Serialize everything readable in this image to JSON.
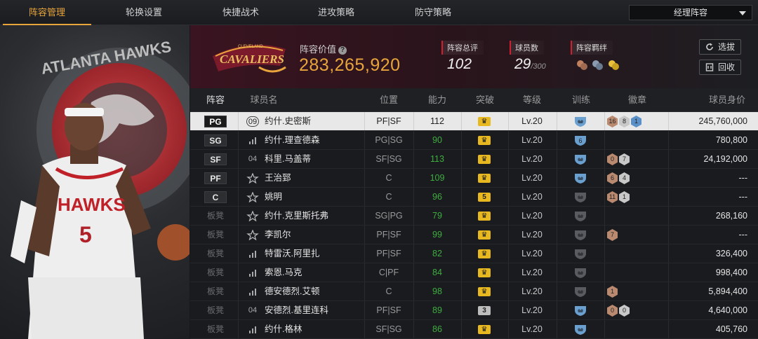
{
  "nav": {
    "tabs": [
      "阵容管理",
      "轮换设置",
      "快捷战术",
      "进攻策略",
      "防守策略"
    ],
    "active_tab": 0,
    "dropdown_value": "经理阵容"
  },
  "summary": {
    "team_logo_text": "CAVALIERS",
    "team_logo_sub": "CLEVELAND",
    "value_label": "阵容价值",
    "value": "283,265,920",
    "overall_label": "阵容总评",
    "overall": "102",
    "players_label": "球员数",
    "players": "29",
    "players_max": "/300",
    "bond_label": "阵容羁绊",
    "select_button": "选拔",
    "recycle_button": "回收"
  },
  "player_art": {
    "ring_text": "ATLANTA HAWKS",
    "jersey_text": "HAWKS",
    "jersey_number": "5"
  },
  "table": {
    "headers": [
      "阵容",
      "球员名",
      "位置",
      "能力",
      "突破",
      "等级",
      "训练",
      "徽章",
      "球员身价"
    ],
    "rows": [
      {
        "slot": "PG",
        "num": "09",
        "num_circle": true,
        "name": "约什.史密斯",
        "pos": "PF|SF",
        "ability": "112",
        "break": "",
        "level": "Lv.20",
        "train": "blue",
        "badges": [
          "16:brown",
          "8:gray",
          "1:blue"
        ],
        "value": "245,760,000",
        "selected": true
      },
      {
        "slot": "SG",
        "num": "bar",
        "name": "约什.理查德森",
        "pos": "PG|SG",
        "ability": "90",
        "break": "",
        "level": "Lv.20",
        "train": "blue6",
        "badges": [],
        "value": "780,800"
      },
      {
        "slot": "SF",
        "num": "04",
        "name": "科里.马盖蒂",
        "pos": "SF|SG",
        "ability": "113",
        "break": "",
        "level": "Lv.20",
        "train": "blue",
        "badges": [
          "0:brown",
          "7:gray"
        ],
        "value": "24,192,000"
      },
      {
        "slot": "PF",
        "num": "star",
        "name": "王治郅",
        "pos": "C",
        "ability": "109",
        "break": "",
        "level": "Lv.20",
        "train": "blue",
        "badges": [
          "6:brown",
          "4:gray"
        ],
        "value": "---"
      },
      {
        "slot": "C",
        "num": "star",
        "name": "姚明",
        "pos": "C",
        "ability": "96",
        "break": "5",
        "level": "Lv.20",
        "train": "gray",
        "badges": [
          "11:brown",
          "1:gray"
        ],
        "value": "---"
      },
      {
        "slot": "板凳",
        "num": "star",
        "name": "约什.克里斯托弗",
        "pos": "SG|PG",
        "ability": "79",
        "break": "",
        "level": "Lv.20",
        "train": "gray",
        "badges": [],
        "value": "268,160"
      },
      {
        "slot": "板凳",
        "num": "star",
        "name": "李凯尔",
        "pos": "PF|SF",
        "ability": "99",
        "break": "",
        "level": "Lv.20",
        "train": "gray",
        "badges": [
          "7:brown"
        ],
        "value": "---"
      },
      {
        "slot": "板凳",
        "num": "bar",
        "name": "特雷沃.阿里扎",
        "pos": "PF|SF",
        "ability": "82",
        "break": "",
        "level": "Lv.20",
        "train": "gray",
        "badges": [],
        "value": "326,400"
      },
      {
        "slot": "板凳",
        "num": "bar",
        "name": "索恩.马克",
        "pos": "C|PF",
        "ability": "84",
        "break": "",
        "level": "Lv.20",
        "train": "gray",
        "badges": [],
        "value": "998,400"
      },
      {
        "slot": "板凳",
        "num": "bar",
        "name": "德安德烈.艾顿",
        "pos": "C",
        "ability": "98",
        "break": "",
        "level": "Lv.20",
        "train": "gray",
        "badges": [
          "1:brown"
        ],
        "value": "5,894,400"
      },
      {
        "slot": "板凳",
        "num": "04",
        "name": "安德烈.基里连科",
        "pos": "PF|SF",
        "ability": "89",
        "break": "3",
        "level": "Lv.20",
        "train": "blue",
        "badges": [
          "0:brown",
          "0:gray"
        ],
        "value": "4,640,000"
      },
      {
        "slot": "板凳",
        "num": "bar",
        "name": "约什.格林",
        "pos": "SF|SG",
        "ability": "86",
        "break": "",
        "level": "Lv.20",
        "train": "blue",
        "badges": [],
        "value": "405,760"
      }
    ]
  },
  "colors": {
    "accent": "#e8a53c",
    "ability_green": "#3fae3f",
    "crown_gold": "#e8b820",
    "train_blue": "#6aa0d0"
  }
}
